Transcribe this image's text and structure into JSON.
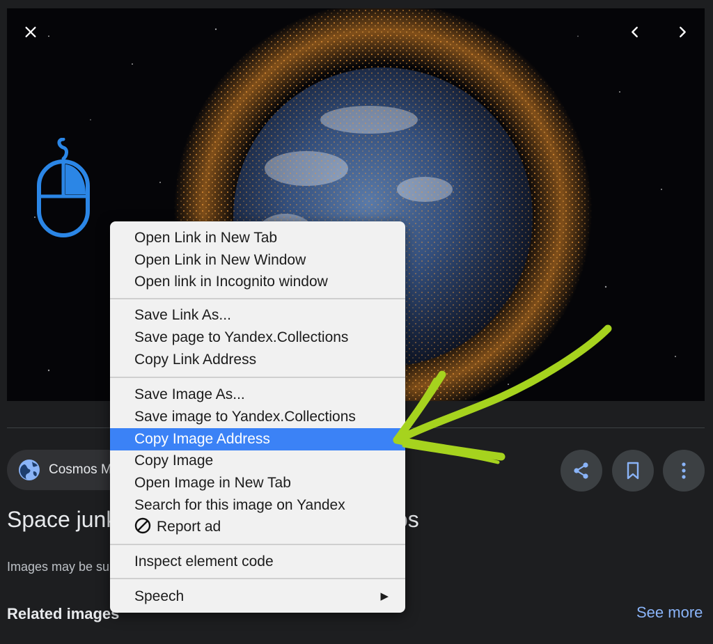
{
  "viewer": {
    "alt": "Space junk debris field orbiting Earth"
  },
  "source": {
    "name": "Cosmos M"
  },
  "page": {
    "title": "Space junk is getting in the way | Cosmos",
    "notice": "Images may be subject to copyright.",
    "related_heading": "Related images",
    "see_more": "See more"
  },
  "context_menu": {
    "group_link": [
      "Open Link in New Tab",
      "Open Link in New Window",
      "Open link in Incognito window"
    ],
    "group_save_link": [
      "Save Link As...",
      "Save page to Yandex.Collections",
      "Copy Link Address"
    ],
    "group_image": [
      "Save Image As...",
      "Save image to Yandex.Collections",
      "Copy Image Address",
      "Copy Image",
      "Open Image in New Tab",
      "Search for this image on Yandex",
      "Report ad"
    ],
    "inspect": "Inspect element code",
    "speech": "Speech",
    "speech_arrow": "▶",
    "highlighted_item": "Copy Image Address"
  },
  "colors": {
    "menu_highlight": "#3b82f6",
    "arrow_annotation": "#a6d31e",
    "mouse_icon": "#2b86e6",
    "link_blue": "#8ab4f8"
  },
  "icons": {
    "close": "close-icon",
    "prev": "chevron-left-icon",
    "next": "chevron-right-icon",
    "mouse": "mouse-icon",
    "globe": "globe-icon",
    "share": "share-icon",
    "bookmark": "bookmark-icon",
    "more": "more-vert-icon",
    "report": "ban-icon"
  }
}
